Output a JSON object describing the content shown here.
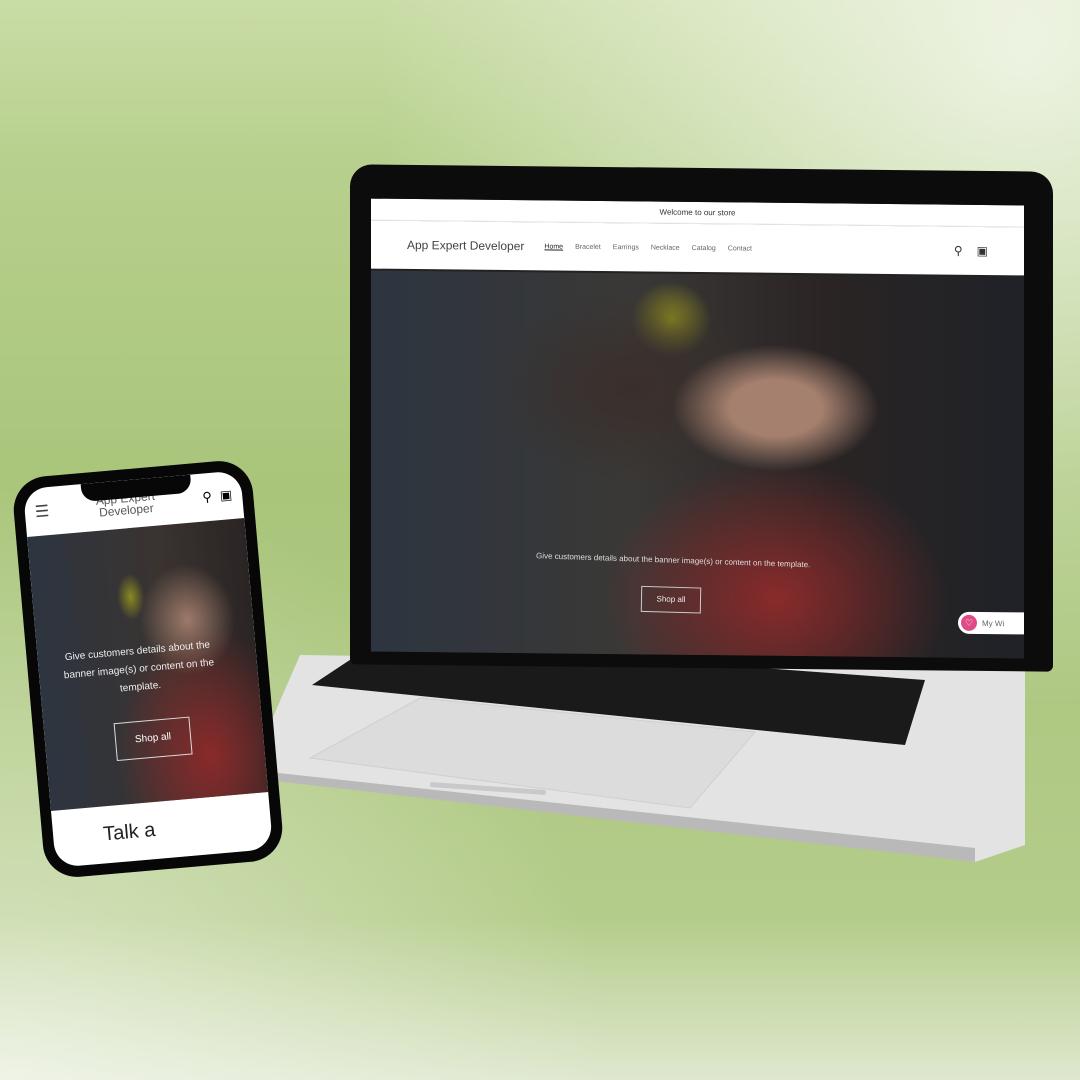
{
  "desktop": {
    "announcement": "Welcome to our store",
    "logo": "App Expert Developer",
    "nav": [
      "Home",
      "Bracelet",
      "Earrings",
      "Necklace",
      "Catalog",
      "Contact"
    ],
    "hero_text": "Give customers details about the banner image(s) or content on the template.",
    "button": "Shop all",
    "wishlist": "My Wi"
  },
  "mobile": {
    "logo_line1": "App Expert",
    "logo_line2": "Developer",
    "hero_text": "Give customers details about the banner image(s) or content on the template.",
    "button": "Shop all",
    "section_heading": "Talk a"
  },
  "colors": {
    "accent": "#e04a86",
    "background": "#b7d08d"
  }
}
